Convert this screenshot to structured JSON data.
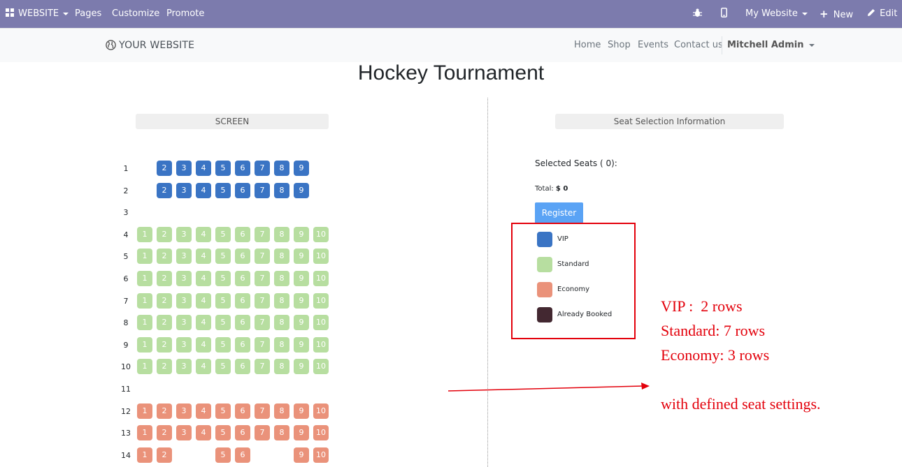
{
  "admin_bar": {
    "website_label": "WEBSITE",
    "pages": "Pages",
    "customize": "Customize",
    "promote": "Promote",
    "my_website": "My Website",
    "new_label": "New",
    "edit_label": "Edit"
  },
  "navbar": {
    "logo_text": "YOUR WEBSITE",
    "links": [
      "Home",
      "Shop",
      "Events",
      "Contact us"
    ],
    "user": "Mitchell Admin"
  },
  "page_title": "Hockey Tournament",
  "screen_label": "SCREEN",
  "info_title": "Seat Selection Information",
  "selected_seats": "Selected Seats ( 0):",
  "total_label": "Total:",
  "total_value": "$ 0",
  "register_label": "Register",
  "legend": [
    {
      "label": "VIP",
      "color": "#3a74c4"
    },
    {
      "label": "Standard",
      "color": "#b7dea0"
    },
    {
      "label": "Economy",
      "color": "#ea927a"
    },
    {
      "label": "Already Booked",
      "color": "#432831"
    }
  ],
  "seat_rows": [
    {
      "row": "1",
      "category": "vip",
      "seats": [
        "2",
        "3",
        "4",
        "5",
        "6",
        "7",
        "8",
        "9"
      ]
    },
    {
      "row": "2",
      "category": "vip",
      "seats": [
        "2",
        "3",
        "4",
        "5",
        "6",
        "7",
        "8",
        "9"
      ]
    },
    {
      "row": "3",
      "category": "none",
      "seats": []
    },
    {
      "row": "4",
      "category": "standard",
      "seats": [
        "1",
        "2",
        "3",
        "4",
        "5",
        "6",
        "7",
        "8",
        "9",
        "10"
      ]
    },
    {
      "row": "5",
      "category": "standard",
      "seats": [
        "1",
        "2",
        "3",
        "4",
        "5",
        "6",
        "7",
        "8",
        "9",
        "10"
      ]
    },
    {
      "row": "6",
      "category": "standard",
      "seats": [
        "1",
        "2",
        "3",
        "4",
        "5",
        "6",
        "7",
        "8",
        "9",
        "10"
      ]
    },
    {
      "row": "7",
      "category": "standard",
      "seats": [
        "1",
        "2",
        "3",
        "4",
        "5",
        "6",
        "7",
        "8",
        "9",
        "10"
      ]
    },
    {
      "row": "8",
      "category": "standard",
      "seats": [
        "1",
        "2",
        "3",
        "4",
        "5",
        "6",
        "7",
        "8",
        "9",
        "10"
      ]
    },
    {
      "row": "9",
      "category": "standard",
      "seats": [
        "1",
        "2",
        "3",
        "4",
        "5",
        "6",
        "7",
        "8",
        "9",
        "10"
      ]
    },
    {
      "row": "10",
      "category": "standard",
      "seats": [
        "1",
        "2",
        "3",
        "4",
        "5",
        "6",
        "7",
        "8",
        "9",
        "10"
      ]
    },
    {
      "row": "11",
      "category": "none",
      "seats": []
    },
    {
      "row": "12",
      "category": "economy",
      "seats": [
        "1",
        "2",
        "3",
        "4",
        "5",
        "6",
        "7",
        "8",
        "9",
        "10"
      ]
    },
    {
      "row": "13",
      "category": "economy",
      "seats": [
        "1",
        "2",
        "3",
        "4",
        "5",
        "6",
        "7",
        "8",
        "9",
        "10"
      ]
    },
    {
      "row": "14",
      "category": "economy",
      "seats": [
        "1",
        "2",
        "5",
        "6",
        "9",
        "10"
      ]
    }
  ],
  "annotation": {
    "vip": "VIP :  2 rows",
    "standard": "Standard: 7 rows",
    "economy": "Economy: 3 rows",
    "note": "with defined seat settings."
  },
  "colors": {
    "admin_bar": "#7c7bad",
    "annotation": "#e3000b",
    "register": "#5aa3f5"
  }
}
